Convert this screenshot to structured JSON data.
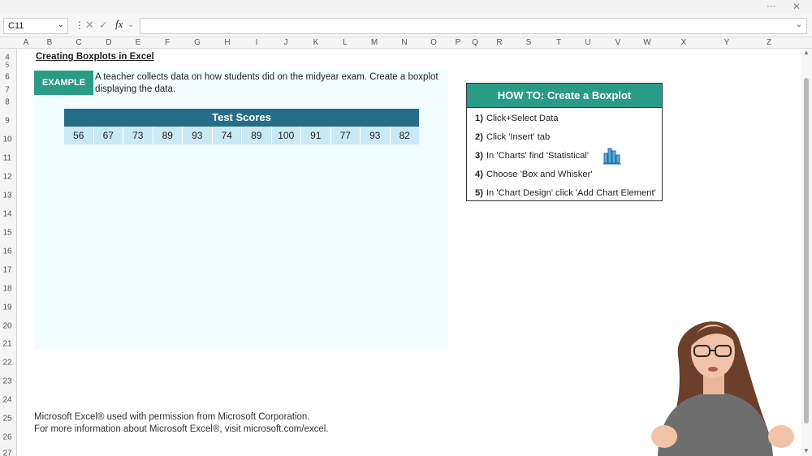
{
  "formula_bar": {
    "name_box": "C11",
    "fx_label": "fx",
    "formula": ""
  },
  "columns": [
    "A",
    "B",
    "C",
    "D",
    "E",
    "F",
    "G",
    "H",
    "I",
    "J",
    "K",
    "L",
    "M",
    "N",
    "O",
    "P",
    "Q",
    "R",
    "S",
    "T",
    "U",
    "V",
    "W",
    "X",
    "Y",
    "Z"
  ],
  "rows": [
    "4",
    "5",
    "6",
    "7",
    "8",
    "9",
    "10",
    "11",
    "12",
    "13",
    "14",
    "15",
    "16",
    "17",
    "18",
    "19",
    "20",
    "21",
    "22",
    "23",
    "24",
    "25",
    "26",
    "27"
  ],
  "sheet": {
    "title": "Creating Boxplots in Excel",
    "example_badge": "EXAMPLE",
    "example_text": "A teacher collects data on how students did on the midyear exam. Create a boxplot displaying the data.",
    "table_title": "Test Scores",
    "scores": [
      "56",
      "67",
      "73",
      "89",
      "93",
      "74",
      "89",
      "100",
      "91",
      "77",
      "93",
      "82"
    ]
  },
  "howto": {
    "title": "HOW TO: Create a Boxplot",
    "steps": [
      {
        "num": "1)",
        "text": "Click+Select Data"
      },
      {
        "num": "2)",
        "text": "Click 'Insert' tab"
      },
      {
        "num": "3)",
        "text": "In 'Charts' find 'Statistical'"
      },
      {
        "num": "4)",
        "text": "Choose 'Box and Whisker'"
      },
      {
        "num": "5)",
        "text": "In 'Chart Design' click 'Add Chart Element'"
      }
    ],
    "icon": "statistical-chart-icon"
  },
  "footer": {
    "line1": "Microsoft Excel® used with permission from Microsoft Corporation.",
    "line2": "For more information about Microsoft Excel®, visit microsoft.com/excel."
  },
  "colors": {
    "accent_green": "#2a9b85",
    "table_header_blue": "#266e87",
    "table_cell_blue": "#cbe9f5",
    "panel_bg": "#f2fdff"
  }
}
